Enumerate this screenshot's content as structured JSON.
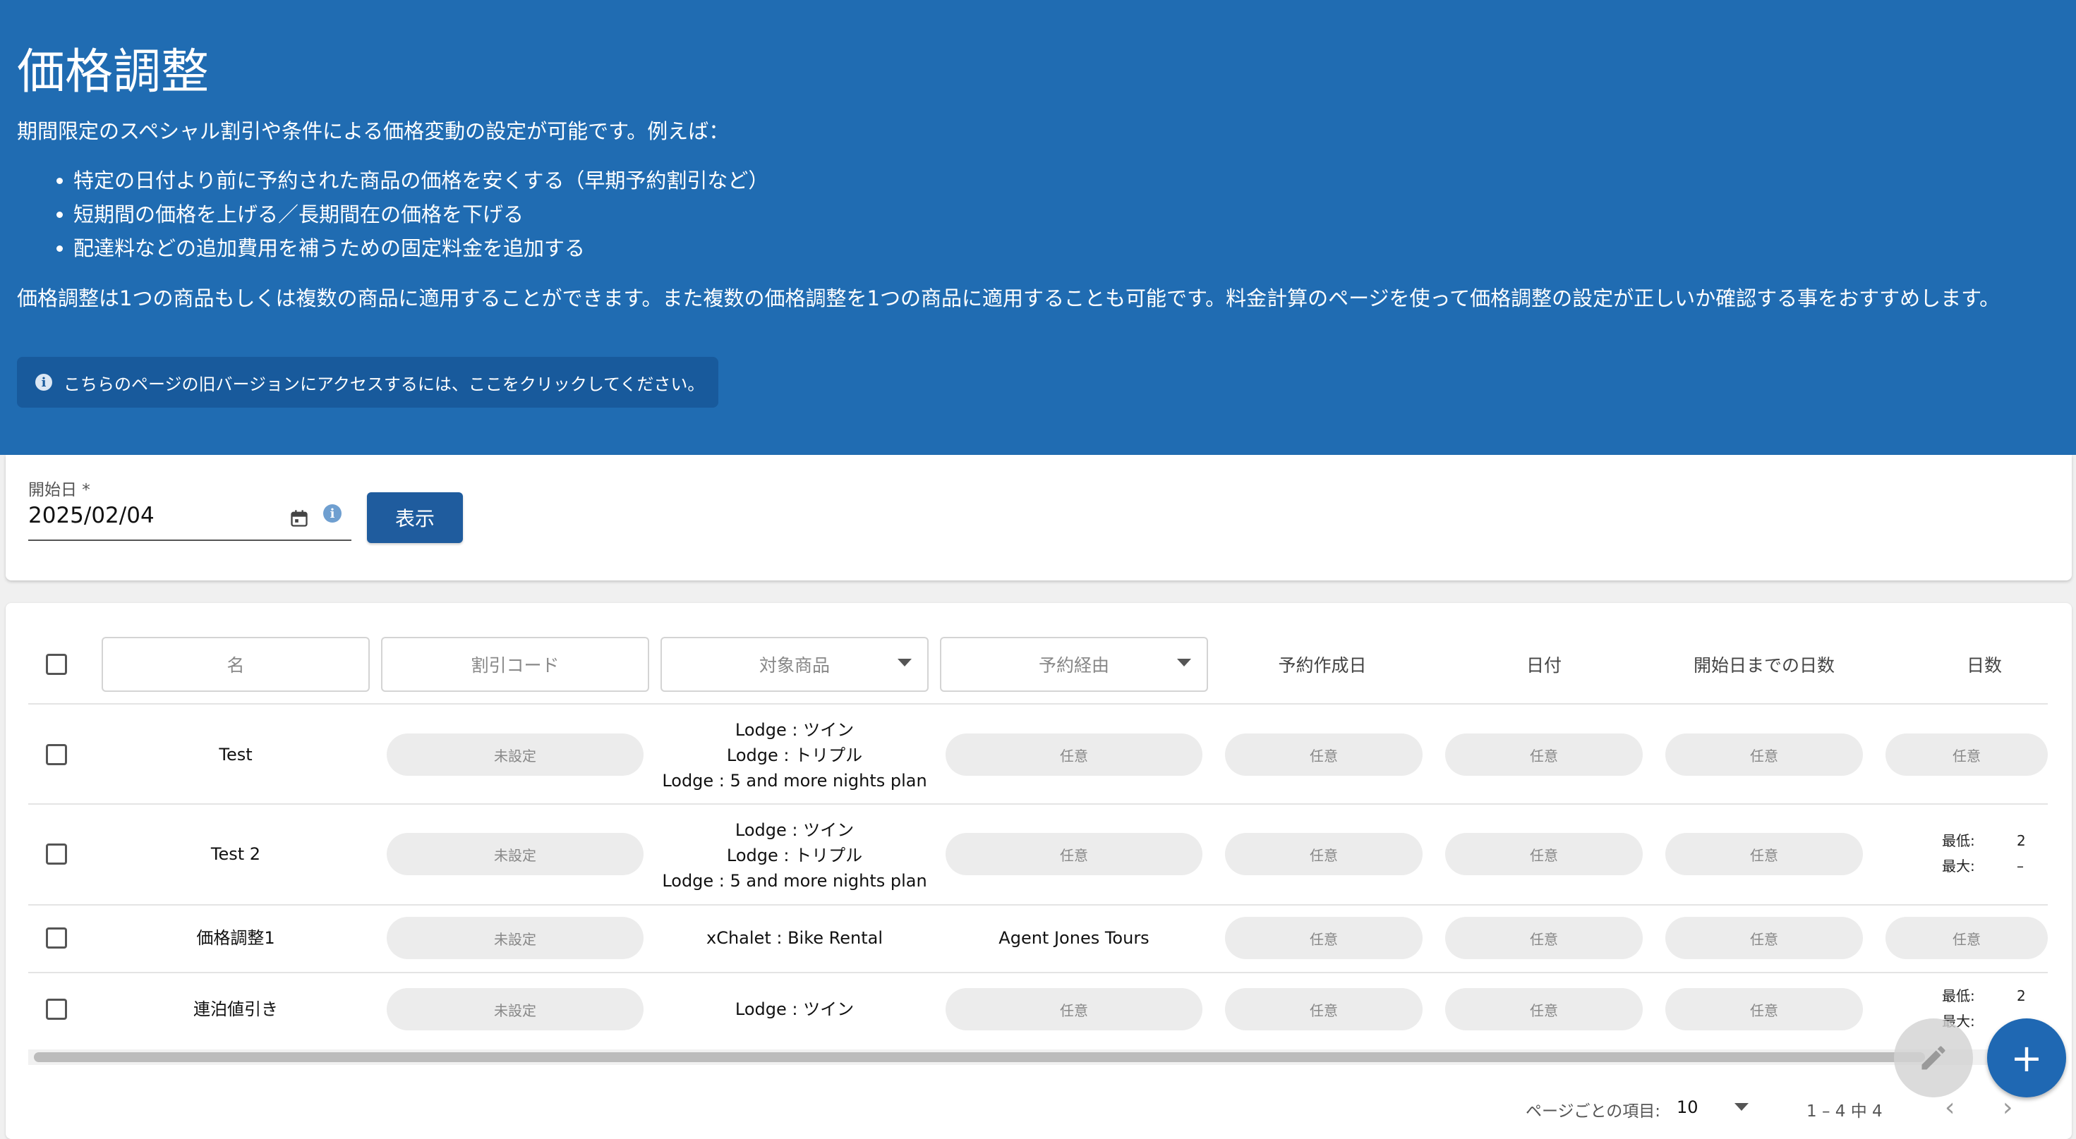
{
  "header": {
    "title": "価格調整",
    "intro": "期間限定のスペシャル割引や条件による価格変動の設定が可能です。例えば：",
    "bullets": [
      "特定の日付より前に予約された商品の価格を安くする（早期予約割引など）",
      "短期間の価格を上げる／長期間在の価格を下げる",
      "配達料などの追加費用を補うための固定料金を追加する"
    ],
    "note": "価格調整は1つの商品もしくは複数の商品に適用することができます。また複数の価格調整を1つの商品に適用することも可能です。料金計算のページを使って価格調整の設定が正しいか確認する事をおすすめします。",
    "banner": "こちらのページの旧バージョンにアクセスするには、ここをクリックしてください。",
    "banner_icon": "i"
  },
  "filter": {
    "date_label": "開始日 *",
    "date_value": "2025/02/04",
    "info_icon": "i",
    "show_button": "表示"
  },
  "table": {
    "filters": {
      "name": "名",
      "discount_code": "割引コード",
      "products": "対象商品",
      "channel": "予約経由"
    },
    "headers": {
      "booking_created": "予約作成日",
      "date": "日付",
      "days_before_start": "開始日までの日数",
      "days": "日数"
    },
    "rows": [
      {
        "name": "Test",
        "code": "未設定",
        "products": [
          "Lodge : ツイン",
          "Lodge : トリプル",
          "Lodge : 5 and more nights plan"
        ],
        "channel": "任意",
        "created": "任意",
        "date": "任意",
        "days_before": "任意",
        "days": "任意"
      },
      {
        "name": "Test 2",
        "code": "未設定",
        "products": [
          "Lodge : ツイン",
          "Lodge : トリプル",
          "Lodge : 5 and more nights plan"
        ],
        "channel": "任意",
        "created": "任意",
        "date": "任意",
        "days_before": "任意",
        "days_min_label": "最低:",
        "days_min": "2",
        "days_max_label": "最大:",
        "days_max": "–"
      },
      {
        "name": "価格調整1",
        "code": "未設定",
        "products": [
          "xChalet : Bike Rental"
        ],
        "channel": "Agent Jones Tours",
        "created": "任意",
        "date": "任意",
        "days_before": "任意",
        "days": "任意"
      },
      {
        "name": "連泊値引き",
        "code": "未設定",
        "products": [
          "Lodge : ツイン"
        ],
        "channel": "任意",
        "created": "任意",
        "date": "任意",
        "days_before": "任意",
        "days_min_label": "最低:",
        "days_min": "2",
        "days_max_label": "最大:"
      }
    ]
  },
  "pagination": {
    "items_per_page_label": "ページごとの項目:",
    "page_size": "10",
    "range": "1 – 4 中 4",
    "prev": "‹",
    "next": "›"
  },
  "fab": {
    "add": "+"
  },
  "colors": {
    "header_bg": "#206cb2",
    "banner_bg": "#185a9c",
    "button_bg": "#1f5c9e",
    "fab_bg": "#1f68b3",
    "pill_bg": "#ececec"
  }
}
